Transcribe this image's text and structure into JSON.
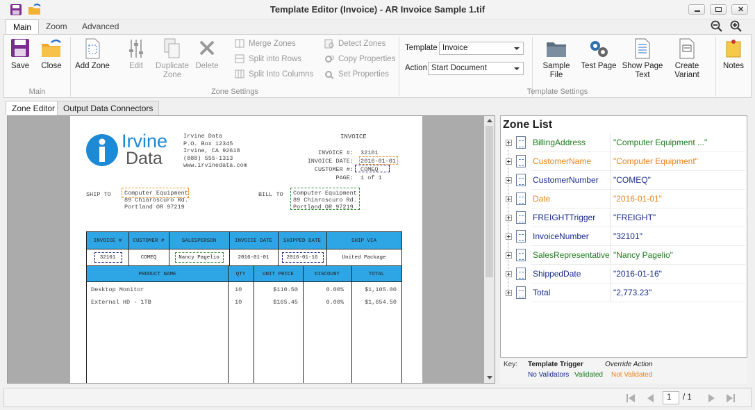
{
  "window": {
    "title": "Template Editor (Invoice) - AR Invoice Sample 1.tif"
  },
  "ribbon_tabs": [
    "Main",
    "Zoom",
    "Advanced"
  ],
  "ribbon": {
    "main": {
      "save": "Save",
      "close": "Close",
      "group": "Main"
    },
    "zone_settings": {
      "add_zone": "Add Zone",
      "edit": "Edit",
      "duplicate_zone_1": "Duplicate",
      "duplicate_zone_2": "Zone",
      "delete": "Delete",
      "merge_zones": "Merge Zones",
      "split_rows": "Split into Rows",
      "split_columns": "Split Into Columns",
      "detect_zones": "Detect Zones",
      "copy_properties": "Copy Properties",
      "set_properties": "Set Properties",
      "group": "Zone Settings"
    },
    "template_settings": {
      "template_label": "Template",
      "template_value": "Invoice",
      "action_label": "Action",
      "action_value": "Start Document",
      "sample_file_1": "Sample",
      "sample_file_2": "File",
      "test_page": "Test Page",
      "show_page_text_1": "Show Page",
      "show_page_text_2": "Text",
      "create_variant_1": "Create",
      "create_variant_2": "Variant",
      "notes": "Notes",
      "group": "Template Settings"
    }
  },
  "doc_tabs": [
    "Zone Editor",
    "Output Data Connectors"
  ],
  "invoice": {
    "logo_top": "Irvine",
    "logo_bottom": "Data",
    "company": [
      "Irvine Data",
      "P.O. Box 12345",
      "Irvine, CA 92618",
      "(888) 555-1313",
      "www.irvinedata.com"
    ],
    "heading": "INVOICE",
    "meta_labels": [
      "INVOICE #:",
      "INVOICE DATE:",
      "CUSTOMER #:",
      "PAGE:"
    ],
    "meta_values": [
      "32101",
      "2016-01-01",
      "COMEQ",
      "1 of 1"
    ],
    "ship_to_label": "SHIP TO",
    "bill_to_label": "BILL TO",
    "ship_to": [
      "Computer Equipment",
      "89 Chiaroscuro Rd.",
      "Portland OR 97219"
    ],
    "bill_to": [
      "Computer Equipment",
      "89 Chiaroscuro Rd.",
      "Portland OR 97219"
    ],
    "header1": [
      "INVOICE #",
      "CUSTOMER #",
      "SALESPERSON",
      "INVOICE DATE",
      "SHIPPED DATE",
      "SHIP VIA"
    ],
    "row1": [
      "32101",
      "COMEQ",
      "Nancy Pagelio",
      "2016-01-01",
      "2016-01-16",
      "United Package"
    ],
    "header2": [
      "PRODUCT NAME",
      "QTY",
      "UNIT PRICE",
      "DISCOUNT",
      "TOTAL"
    ],
    "items": [
      [
        "Desktop Monitor",
        "10",
        "$110.50",
        "0.00%",
        "$1,105.00"
      ],
      [
        "External HD - 1TB",
        "10",
        "$165.45",
        "0.00%",
        "$1,654.50"
      ]
    ]
  },
  "zone_list": {
    "title": "Zone List",
    "zones": [
      {
        "name": "BillingAddress",
        "value": "\"Computer Equipment ...\"",
        "status": "green"
      },
      {
        "name": "CustomerName",
        "value": "\"Computer Equipment\"",
        "status": "orange"
      },
      {
        "name": "CustomerNumber",
        "value": "\"COMEQ\"",
        "status": "navy"
      },
      {
        "name": "Date",
        "value": "\"2016-01-01\"",
        "status": "orange"
      },
      {
        "name": "FREIGHTTrigger",
        "value": "\"FREIGHT\"",
        "status": "navy"
      },
      {
        "name": "InvoiceNumber",
        "value": "\"32101\"",
        "status": "navy"
      },
      {
        "name": "SalesRepresentative",
        "value": "\"Nancy Pagelio\"",
        "status": "green"
      },
      {
        "name": "ShippedDate",
        "value": "\"2016-01-16\"",
        "status": "navy"
      },
      {
        "name": "Total",
        "value": "\"2,773.23\"",
        "status": "navy"
      }
    ],
    "key": {
      "label": "Key:",
      "template_trigger": "Template Trigger",
      "override_action": "Override Action",
      "no_validators": "No Validators",
      "validated": "Validated",
      "not_validated": "Not Validated"
    }
  },
  "pager": {
    "current": "1",
    "total": "/ 1"
  },
  "colors": {
    "green": "#1f7a1f",
    "orange": "#e8841a",
    "navy": "#1a2c8a",
    "accent": "#2ea5e4"
  }
}
